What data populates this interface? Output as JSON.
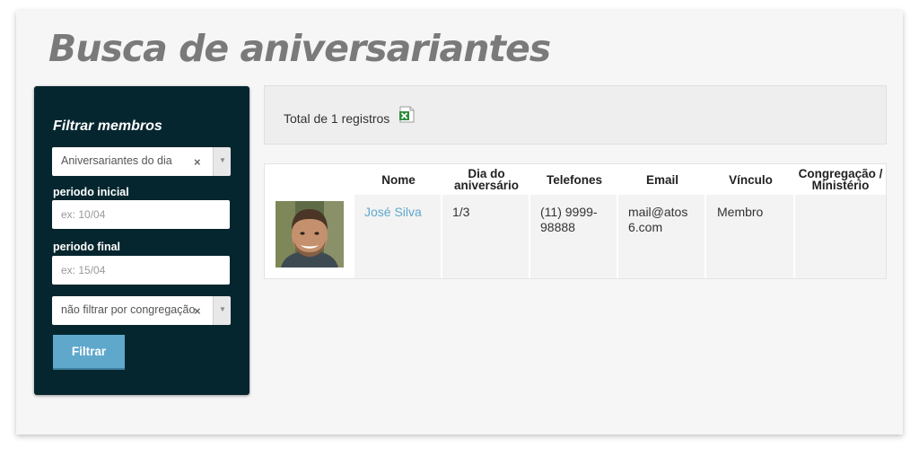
{
  "page": {
    "title": "Busca de aniversariantes"
  },
  "filter": {
    "title": "Filtrar membros",
    "type_select": {
      "value": "Aniversariantes do dia",
      "clear": "×",
      "arrow": "▼"
    },
    "start_label": "periodo inicial",
    "start_placeholder": "ex: 10/04",
    "end_label": "periodo final",
    "end_placeholder": "ex: 15/04",
    "congregation_select": {
      "value": "não filtrar por congregação",
      "clear": "×",
      "arrow": "▼"
    },
    "submit_label": "Filtrar"
  },
  "summary": {
    "text": "Total de 1 registros",
    "export_icon": "excel-icon"
  },
  "table": {
    "headers": {
      "name": "Nome",
      "birthday_1": "Dia do",
      "birthday_2": "aniversário",
      "phones": "Telefones",
      "email": "Email",
      "link": "Vínculo",
      "congregation_1": "Congregação /",
      "congregation_2": "Ministério"
    },
    "rows": [
      {
        "name": "José Silva",
        "birthday": "1/3",
        "phone_1": "(11) 9999-",
        "phone_2": "98888",
        "email_1": "mail@atos",
        "email_2": "6.com",
        "link": "Membro",
        "congregation": ""
      }
    ]
  },
  "colors": {
    "panel_bg": "#06262f",
    "accent": "#5fa8cc",
    "title_gray": "#7a7a7a"
  }
}
